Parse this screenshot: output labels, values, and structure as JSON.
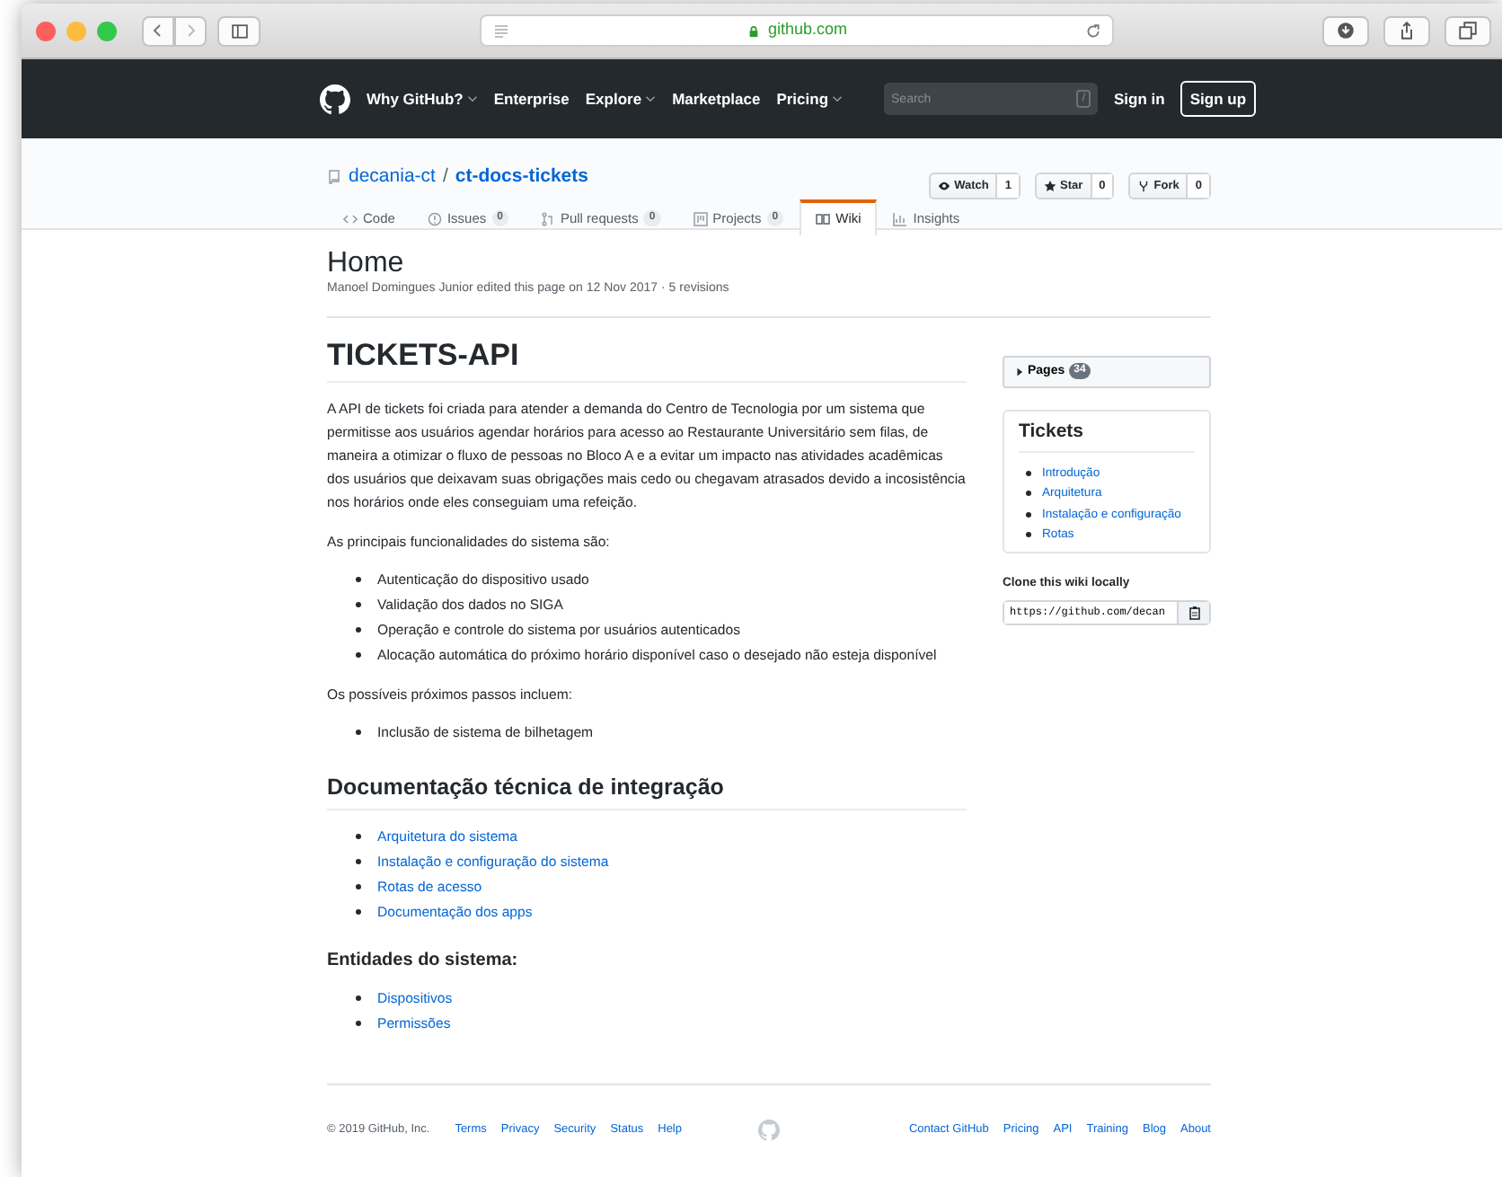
{
  "browser": {
    "url": "github.com"
  },
  "header": {
    "nav": [
      {
        "label": "Why GitHub?",
        "dropdown": true
      },
      {
        "label": "Enterprise",
        "dropdown": false
      },
      {
        "label": "Explore",
        "dropdown": true
      },
      {
        "label": "Marketplace",
        "dropdown": false
      },
      {
        "label": "Pricing",
        "dropdown": true
      }
    ],
    "search": {
      "placeholder": "Search",
      "key": "/"
    },
    "sign_in": "Sign in",
    "sign_up": "Sign up"
  },
  "repo": {
    "owner": "decania-ct",
    "separator": "/",
    "name": "ct-docs-tickets",
    "actions": [
      {
        "kind": "watch",
        "label": "Watch",
        "count": "1"
      },
      {
        "kind": "star",
        "label": "Star",
        "count": "0"
      },
      {
        "kind": "fork",
        "label": "Fork",
        "count": "0"
      }
    ],
    "tabs": [
      {
        "kind": "code",
        "label": "Code",
        "selected": false
      },
      {
        "kind": "issues",
        "label": "Issues",
        "counter": "0",
        "selected": false
      },
      {
        "kind": "pulls",
        "label": "Pull requests",
        "counter": "0",
        "selected": false
      },
      {
        "kind": "projects",
        "label": "Projects",
        "counter": "0",
        "selected": false
      },
      {
        "kind": "wiki",
        "label": "Wiki",
        "selected": true
      },
      {
        "kind": "insights",
        "label": "Insights",
        "selected": false
      }
    ]
  },
  "page": {
    "title": "Home",
    "meta": "Manoel Domingues Junior edited this page on 12 Nov 2017 · 5 revisions",
    "content": [
      {
        "kind": "h1",
        "text": "TICKETS-API"
      },
      {
        "kind": "paragraph",
        "text": "A API de tickets foi criada para atender a demanda do Centro de Tecnologia por um sistema que permitisse aos usuários agendar horários para acesso ao Restaurante Universitário sem filas, de maneira a otimizar o fluxo de pessoas no Bloco A e a evitar um impacto nas atividades acadêmicas dos usuários que deixavam suas obrigações mais cedo ou chegavam atrasados devido a incosistência nos horários onde eles conseguiam uma refeição."
      },
      {
        "kind": "paragraph",
        "text": "As principais funcionalidades do sistema são:"
      },
      {
        "kind": "list",
        "items": [
          "Autenticação do dispositivo usado",
          "Validação dos dados no SIGA",
          "Operação e controle do sistema por usuários autenticados",
          "Alocação automática do próximo horário disponível caso o desejado não esteja disponível"
        ]
      },
      {
        "kind": "paragraph",
        "text": "Os possíveis próximos passos incluem:"
      },
      {
        "kind": "list",
        "items": [
          "Inclusão de sistema de bilhetagem"
        ]
      },
      {
        "kind": "h2",
        "text": "Documentação técnica de integração"
      },
      {
        "kind": "links",
        "items": [
          "Arquitetura do sistema",
          "Instalação e configuração do sistema",
          "Rotas de acesso",
          "Documentação dos apps"
        ]
      },
      {
        "kind": "h3",
        "text": "Entidades do sistema:"
      },
      {
        "kind": "links",
        "items": [
          "Dispositivos",
          "Permissões"
        ]
      }
    ]
  },
  "sidebar": {
    "pages": {
      "label": "Pages",
      "count": "34",
      "expanded": false
    },
    "toc": {
      "title": "Tickets",
      "items": [
        "Introdução",
        "Arquitetura",
        "Instalação e configuração",
        "Rotas"
      ]
    },
    "clone": {
      "label": "Clone this wiki locally",
      "url": "https://github.com/decan"
    }
  },
  "footer": {
    "copyright": "© 2019 GitHub, Inc.",
    "left_links": [
      "Terms",
      "Privacy",
      "Security",
      "Status",
      "Help"
    ],
    "right_links": [
      "Contact GitHub",
      "Pricing",
      "API",
      "Training",
      "Blog",
      "About"
    ]
  }
}
